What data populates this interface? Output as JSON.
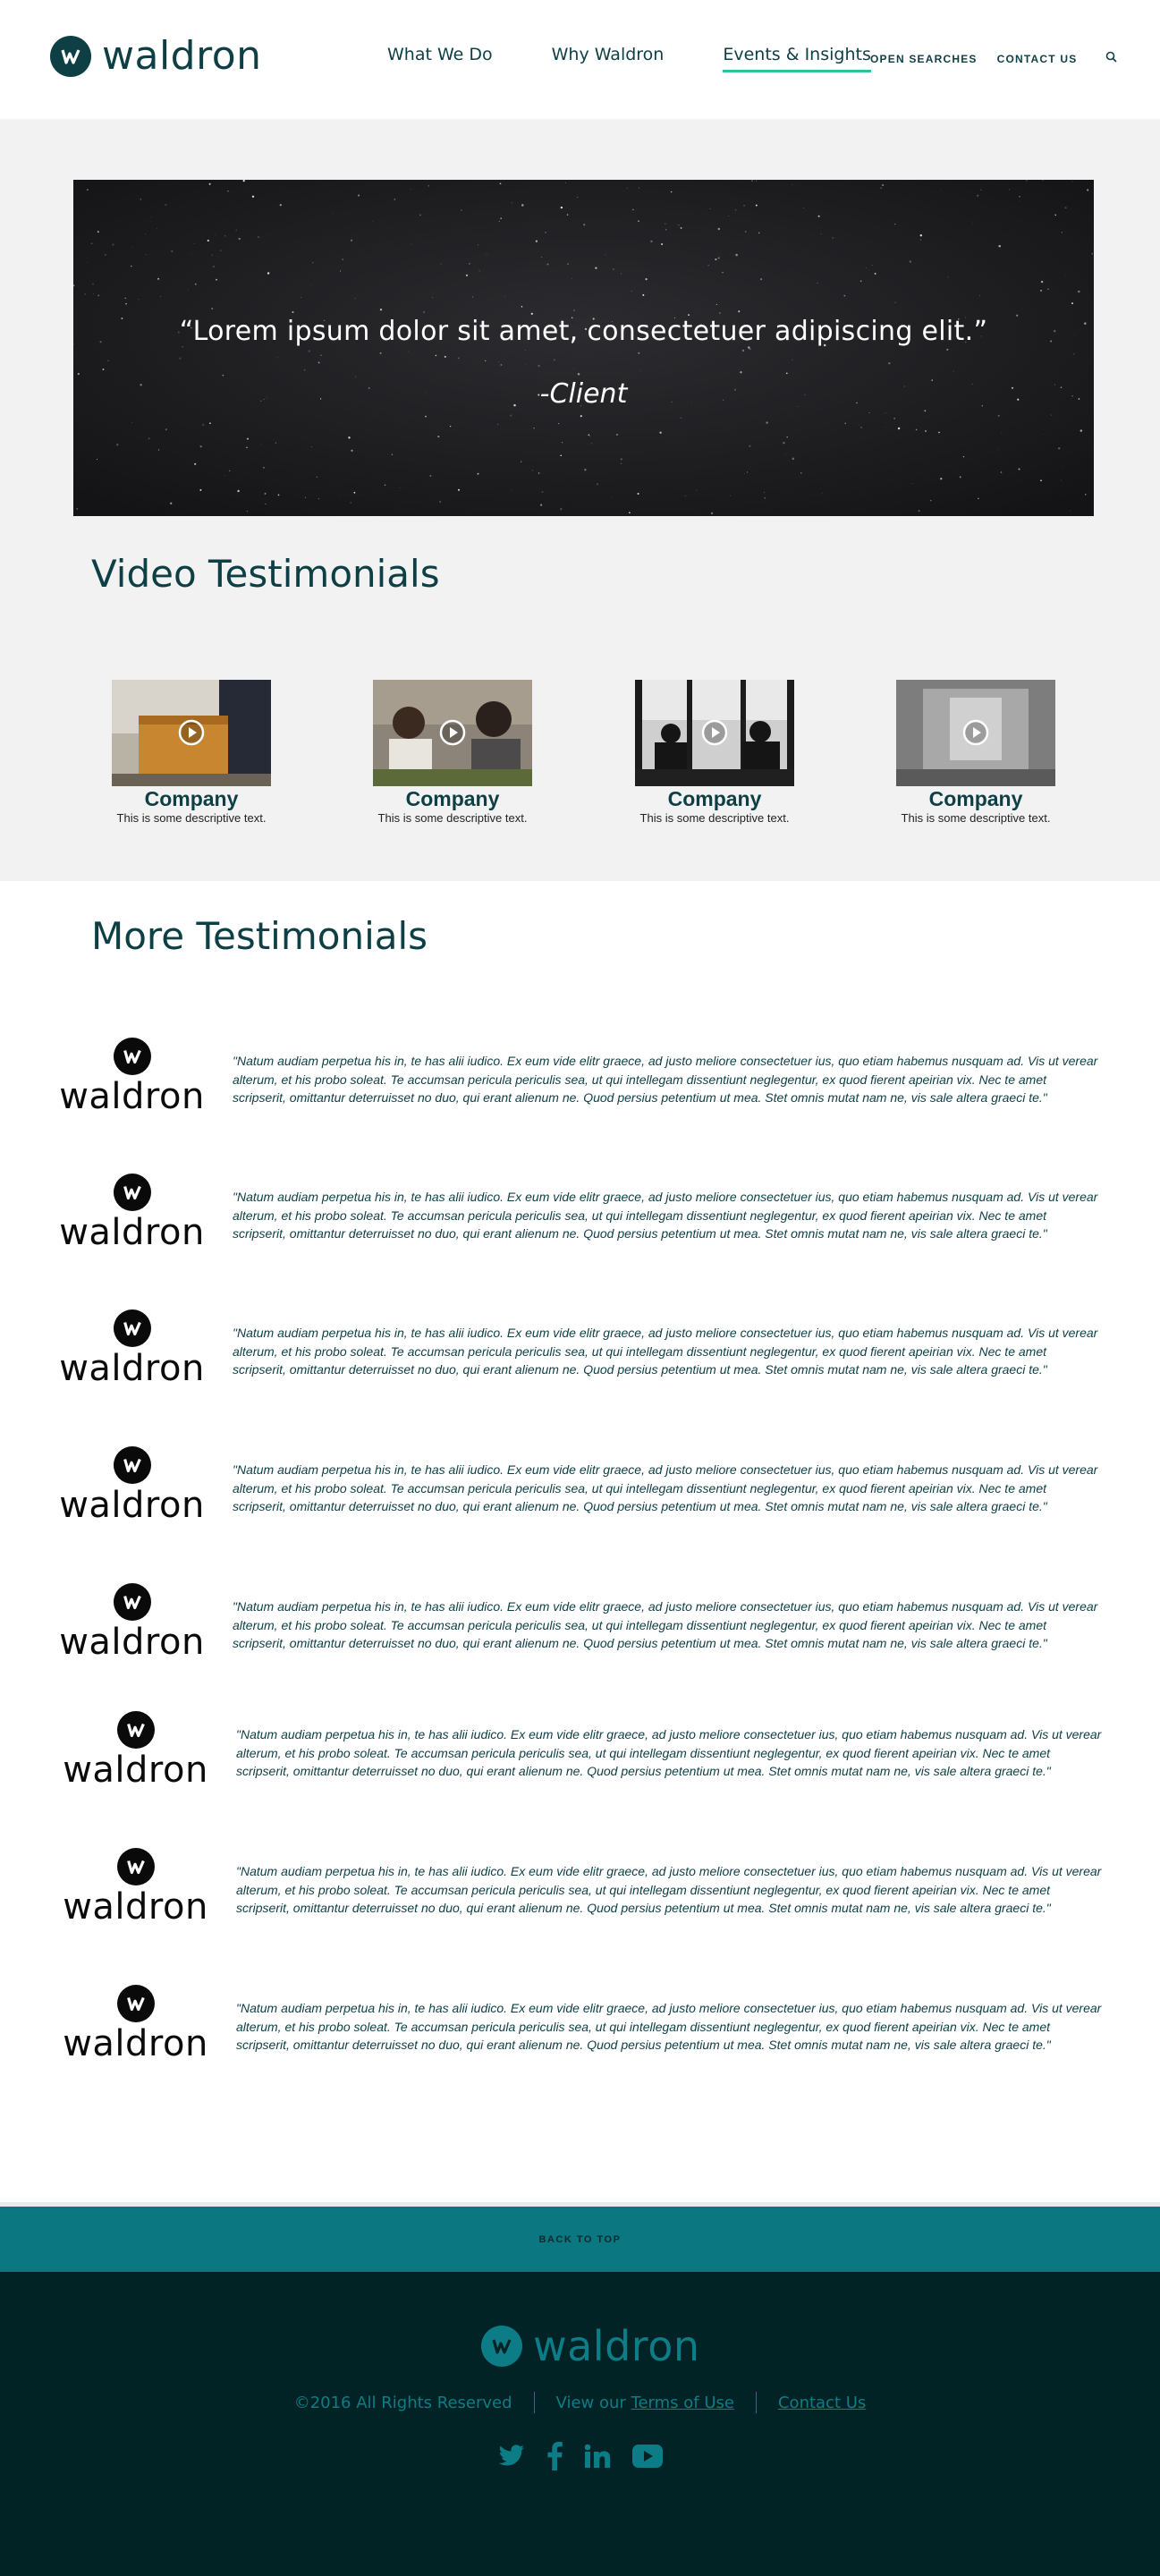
{
  "header": {
    "logo_text": "waldron",
    "nav": [
      "What We Do",
      "Why Waldron",
      "Events & Insights"
    ],
    "utility": [
      "OPEN SEARCHES",
      "CONTACT US"
    ]
  },
  "hero": {
    "quote": "“Lorem ipsum dolor sit amet, consectetuer adipiscing elit.”",
    "cite": "-Client"
  },
  "video_section": {
    "title": "Video Testimonials",
    "cards": [
      {
        "company": "Company",
        "desc": "This is some descriptive text."
      },
      {
        "company": "Company",
        "desc": "This is some descriptive text."
      },
      {
        "company": "Company",
        "desc": "This is some descriptive text."
      },
      {
        "company": "Company",
        "desc": "This is some descriptive text."
      }
    ]
  },
  "more_section": {
    "title": "More Testimonials",
    "logo_text": "waldron",
    "items": [
      "\"Natum audiam perpetua his in, te has alii iudico. Ex eum vide elitr graece, ad justo meliore consectetuer ius, quo etiam habemus nusquam ad. Vis ut verear alterum, et his probo soleat. Te accumsan pericula periculis sea, ut qui intellegam dissentiunt neglegentur, ex quod fierent apeirian vix. Nec te amet scripserit, omittantur deterruisset no duo, qui erant alienum ne. Quod persius petentium ut mea. Stet omnis mutat nam ne, vis sale altera graeci te.\"",
      "\"Natum audiam perpetua his in, te has alii iudico. Ex eum vide elitr graece, ad justo meliore consectetuer ius, quo etiam habemus nusquam ad. Vis ut verear alterum, et his probo soleat. Te accumsan pericula periculis sea, ut qui intellegam dissentiunt neglegentur, ex quod fierent apeirian vix. Nec te amet scripserit, omittantur deterruisset no duo, qui erant alienum ne. Quod persius petentium ut mea. Stet omnis mutat nam ne, vis sale altera graeci te.\"",
      "\"Natum audiam perpetua his in, te has alii iudico. Ex eum vide elitr graece, ad justo meliore consectetuer ius, quo etiam habemus nusquam ad. Vis ut verear alterum, et his probo soleat. Te accumsan pericula periculis sea, ut qui intellegam dissentiunt neglegentur, ex quod fierent apeirian vix. Nec te amet scripserit, omittantur deterruisset no duo, qui erant alienum ne. Quod persius petentium ut mea. Stet omnis mutat nam ne, vis sale altera graeci te.\"",
      "\"Natum audiam perpetua his in, te has alii iudico. Ex eum vide elitr graece, ad justo meliore consectetuer ius, quo etiam habemus nusquam ad. Vis ut verear alterum, et his probo soleat. Te accumsan pericula periculis sea, ut qui intellegam dissentiunt neglegentur, ex quod fierent apeirian vix. Nec te amet scripserit, omittantur deterruisset no duo, qui erant alienum ne. Quod persius petentium ut mea. Stet omnis mutat nam ne, vis sale altera graeci te.\"",
      "\"Natum audiam perpetua his in, te has alii iudico. Ex eum vide elitr graece, ad justo meliore consectetuer ius, quo etiam habemus nusquam ad. Vis ut verear alterum, et his probo soleat. Te accumsan pericula periculis sea, ut qui intellegam dissentiunt neglegentur, ex quod fierent apeirian vix. Nec te amet scripserit, omittantur deterruisset no duo, qui erant alienum ne. Quod persius petentium ut mea. Stet omnis mutat nam ne, vis sale altera graeci te.\"",
      "\"Natum audiam perpetua his in, te has alii iudico. Ex eum vide elitr graece, ad justo meliore consectetuer ius, quo etiam habemus nusquam ad. Vis ut verear alterum, et his probo soleat. Te accumsan pericula periculis sea, ut qui intellegam dissentiunt neglegentur, ex quod fierent apeirian vix. Nec te amet scripserit, omittantur deterruisset no duo, qui erant alienum ne. Quod persius petentium ut mea. Stet omnis mutat nam ne, vis sale altera graeci te.\"",
      "\"Natum audiam perpetua his in, te has alii iudico. Ex eum vide elitr graece, ad justo meliore consectetuer ius, quo etiam habemus nusquam ad. Vis ut verear alterum, et his probo soleat. Te accumsan pericula periculis sea, ut qui intellegam dissentiunt neglegentur, ex quod fierent apeirian vix. Nec te amet scripserit, omittantur deterruisset no duo, qui erant alienum ne. Quod persius petentium ut mea. Stet omnis mutat nam ne, vis sale altera graeci te.\"",
      "\"Natum audiam perpetua his in, te has alii iudico. Ex eum vide elitr graece, ad justo meliore consectetuer ius, quo etiam habemus nusquam ad. Vis ut verear alterum, et his probo soleat. Te accumsan pericula periculis sea, ut qui intellegam dissentiunt neglegentur, ex quod fierent apeirian vix. Nec te amet scripserit, omittantur deterruisset no duo, qui erant alienum ne. Quod persius petentium ut mea. Stet omnis mutat nam ne, vis sale altera graeci te.\""
    ]
  },
  "footer": {
    "back_to_top": "BACK TO TOP",
    "logo_text": "waldron",
    "copyright": "©2016 All Rights Reserved",
    "view_our": "View our",
    "terms": "Terms of Use",
    "contact": "Contact Us",
    "social_icons": [
      "twitter-icon",
      "facebook-icon",
      "linkedin-icon",
      "youtube-icon"
    ]
  },
  "colors": {
    "brand_dark": "#0e3f45",
    "accent_green": "#2fc39c",
    "teal": "#0b7780",
    "footer_bg": "#022326",
    "grey_bg": "#f1f2f1"
  }
}
